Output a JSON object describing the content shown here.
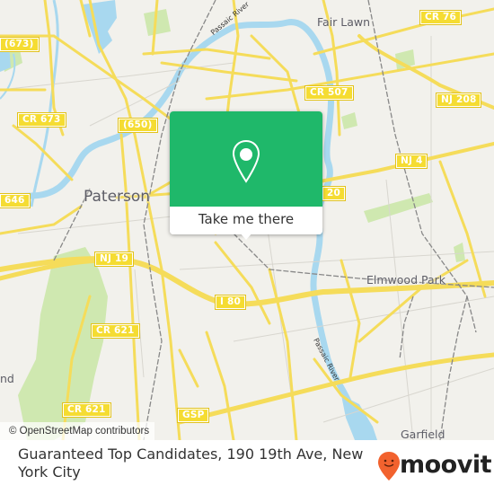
{
  "map": {
    "colors": {
      "land": "#f2f1ec",
      "water": "#a8d8ef",
      "park": "#cfe8b0",
      "road": "#f5dc5a",
      "road_outline": "#e8c94a",
      "rail": "#777777",
      "popup_green": "#1fb86a",
      "brand_orange": "#f2622e"
    },
    "place_labels": [
      {
        "name": "paterson",
        "text": "Paterson"
      },
      {
        "name": "fair-lawn",
        "text": "Fair Lawn"
      },
      {
        "name": "elmwood-park",
        "text": "Elmwood Park"
      },
      {
        "name": "garfield",
        "text": "Garfield"
      },
      {
        "name": "partial-place",
        "text": "nd"
      }
    ],
    "road_shields": [
      {
        "name": "road-shield-673-paren",
        "text": "(673)"
      },
      {
        "name": "road-shield-cr-673",
        "text": "CR 673"
      },
      {
        "name": "road-shield-650",
        "text": "(650)"
      },
      {
        "name": "road-shield-646",
        "text": "646"
      },
      {
        "name": "road-shield-nj-19",
        "text": "NJ 19"
      },
      {
        "name": "road-shield-cr-621-a",
        "text": "CR 621"
      },
      {
        "name": "road-shield-cr-621-b",
        "text": "CR 621"
      },
      {
        "name": "road-shield-i-80",
        "text": "I 80"
      },
      {
        "name": "road-shield-gsp",
        "text": "GSP"
      },
      {
        "name": "road-shield-cr-76",
        "text": "CR 76"
      },
      {
        "name": "road-shield-cr-507",
        "text": "CR 507"
      },
      {
        "name": "road-shield-nj-208",
        "text": "NJ 208"
      },
      {
        "name": "road-shield-nj-4",
        "text": "NJ 4"
      },
      {
        "name": "road-shield-20",
        "text": "20"
      }
    ],
    "river_labels": [
      {
        "name": "passaic-river-label-north",
        "text": "Passaic River"
      },
      {
        "name": "passaic-river-label-south",
        "text": "Passaic River"
      }
    ],
    "attribution": "© OpenStreetMap contributors"
  },
  "popup": {
    "icon": "map-pin-icon",
    "button_label": "Take me there"
  },
  "footer": {
    "address": "Guaranteed Top Candidates, 190 19th Ave, New York City",
    "brand": "moovit",
    "brand_icon": "moovit-smiley-pin-icon"
  }
}
